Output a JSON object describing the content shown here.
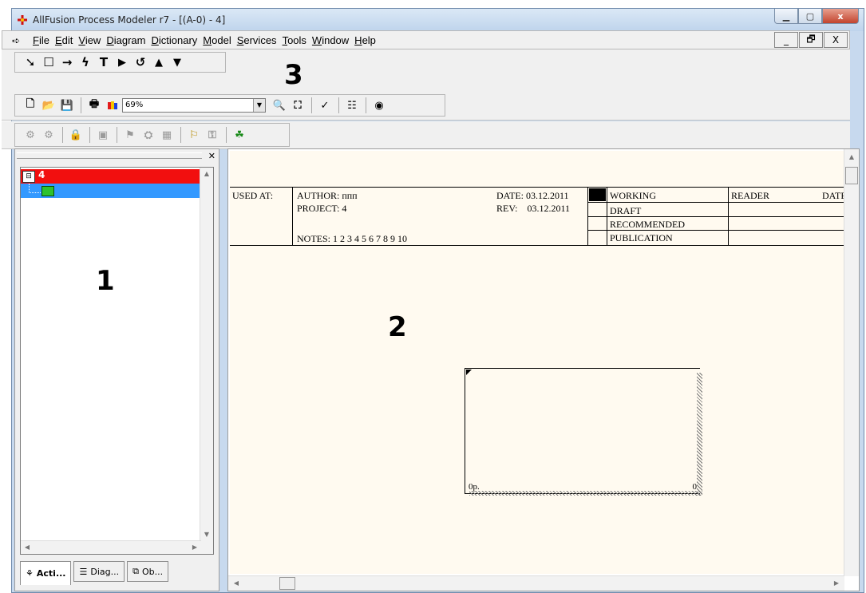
{
  "window": {
    "title": "AllFusion Process Modeler r7 - [(A-0) - 4]"
  },
  "title_buttons": [
    "▁",
    "▢",
    "x"
  ],
  "menu": {
    "items": [
      "File",
      "Edit",
      "View",
      "Diagram",
      "Dictionary",
      "Model",
      "Services",
      "Tools",
      "Window",
      "Help"
    ],
    "mdi_buttons": [
      "_",
      "🗗",
      "X"
    ]
  },
  "toolbars": {
    "zoom_value": "69%"
  },
  "annotations": {
    "one": "1",
    "two": "2",
    "three": "3"
  },
  "tree": {
    "root_label": "4",
    "root_color": "#f20f0f",
    "child_color": "#3399ff"
  },
  "tabs": [
    {
      "label": "Acti...",
      "icon": "activity-tree-icon"
    },
    {
      "label": "Diag...",
      "icon": "diagram-list-icon"
    },
    {
      "label": "Ob...",
      "icon": "objects-icon"
    }
  ],
  "frame": {
    "used_at": "USED AT:",
    "author": "AUTHOR: ппп",
    "project": "PROJECT: 4",
    "date": "DATE: 03.12.2011",
    "rev": "REV:    03.12.2011",
    "notes": "NOTES: 1 2 3 4 5 6 7 8 9 10",
    "statuses": [
      "WORKING",
      "DRAFT",
      "RECOMMENDED",
      "PUBLICATION"
    ],
    "reader": "READER",
    "date_col": "DATE"
  },
  "activity_box": {
    "left_label": "0р.",
    "right_label": "0"
  }
}
